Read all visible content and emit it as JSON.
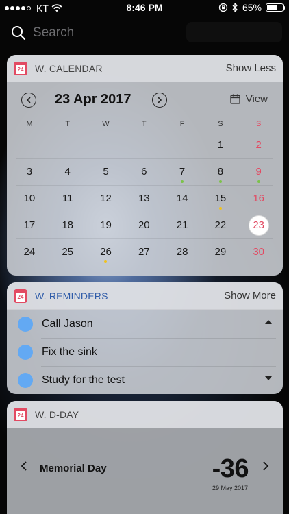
{
  "status_bar": {
    "carrier": "KT",
    "time": "8:46 PM",
    "battery": "65%",
    "signal_dots_filled": 4,
    "signal_dots_total": 5,
    "battery_level": 0.65
  },
  "search": {
    "placeholder": "Search"
  },
  "calendar_widget": {
    "app_icon_text": "24",
    "title": "W. CALENDAR",
    "action": "Show Less",
    "month_title": "23 Apr 2017",
    "view_label": "View",
    "weekdays": [
      "M",
      "T",
      "W",
      "T",
      "F",
      "S",
      "S"
    ],
    "weeks": [
      [
        "",
        "",
        "",
        "",
        "",
        "1",
        "2"
      ],
      [
        "3",
        "4",
        "5",
        "6",
        "7",
        "8",
        "9"
      ],
      [
        "10",
        "11",
        "12",
        "13",
        "14",
        "15",
        "16"
      ],
      [
        "17",
        "18",
        "19",
        "20",
        "21",
        "22",
        "23"
      ],
      [
        "24",
        "25",
        "26",
        "27",
        "28",
        "29",
        "30"
      ]
    ],
    "today": "23",
    "event_dots": [
      {
        "day": "7",
        "color": "#7cc24a"
      },
      {
        "day": "8",
        "color": "#7cc24a"
      },
      {
        "day": "9",
        "color": "#7cc24a"
      },
      {
        "day": "15",
        "color": "#f1c21b"
      },
      {
        "day": "26",
        "color": "#f1c21b"
      }
    ],
    "sunday_color": "#e24a62"
  },
  "reminders_widget": {
    "app_icon_text": "24",
    "title": "W. REMINDERS",
    "action": "Show More",
    "items": [
      {
        "text": "Call Jason"
      },
      {
        "text": "Fix the sink"
      },
      {
        "text": "Study for the test"
      }
    ]
  },
  "dday_widget": {
    "app_icon_text": "24",
    "title": "W. D-DAY",
    "event_name": "Memorial Day",
    "count": "-36",
    "date": "29 May 2017"
  },
  "colors": {
    "accent_red": "#e24a62",
    "reminder_circle": "#63a9f3",
    "reminders_title": "#2d5aa8"
  }
}
